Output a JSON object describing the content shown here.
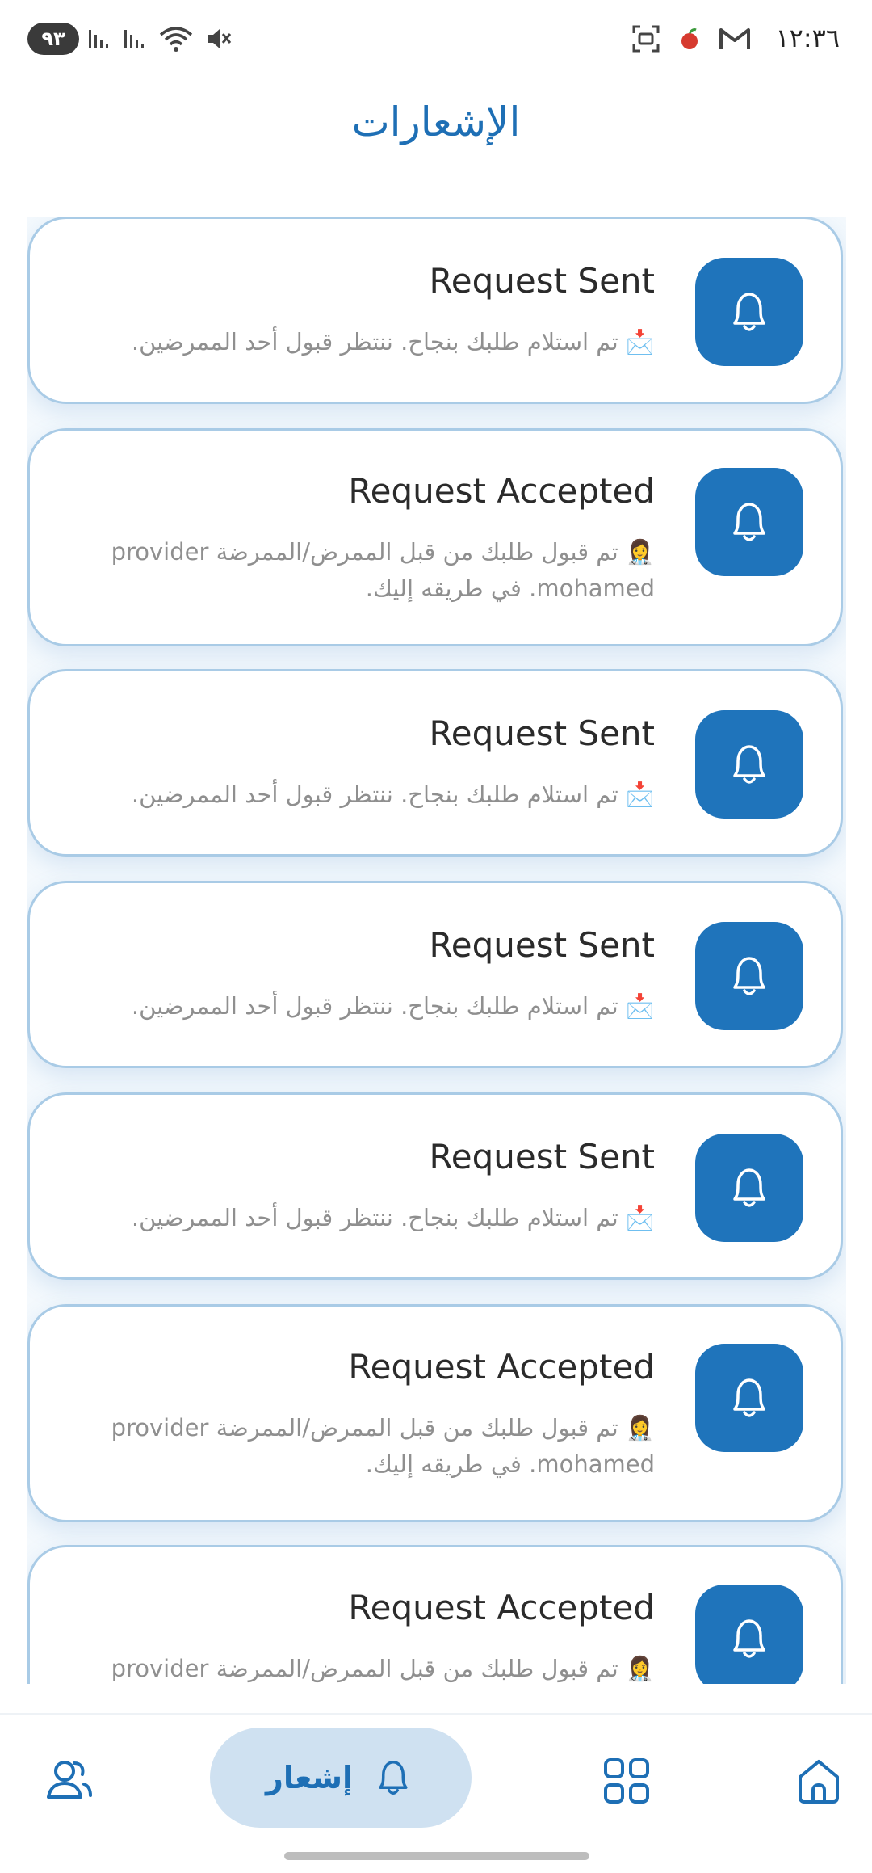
{
  "status_bar": {
    "time": "١٢:٣٦",
    "battery": "٩٣",
    "icons": [
      "mute-icon",
      "wifi-icon",
      "signal-icon",
      "signal-icon",
      "screenshot-icon",
      "app-notification-icon",
      "gmail-icon"
    ]
  },
  "page": {
    "title": "الإشعارات"
  },
  "notifications": [
    {
      "title": "Request Sent",
      "body_line1": "📩 تم استلام طلبك بنجاح. ننتظر قبول أحد الممرضين.",
      "body_line2": ""
    },
    {
      "title": "Request Accepted",
      "body_line1": "👩‍⚕️ تم قبول طلبك من قبل الممرض/الممرضة provider",
      "body_line2": "mohamed. في طريقه إليك."
    },
    {
      "title": "Request Sent",
      "body_line1": "📩 تم استلام طلبك بنجاح. ننتظر قبول أحد الممرضين.",
      "body_line2": ""
    },
    {
      "title": "Request Sent",
      "body_line1": "📩 تم استلام طلبك بنجاح. ننتظر قبول أحد الممرضين.",
      "body_line2": ""
    },
    {
      "title": "Request Sent",
      "body_line1": "📩 تم استلام طلبك بنجاح. ننتظر قبول أحد الممرضين.",
      "body_line2": ""
    },
    {
      "title": "Request Accepted",
      "body_line1": "👩‍⚕️ تم قبول طلبك من قبل الممرض/الممرضة provider",
      "body_line2": "mohamed. في طريقه إليك."
    },
    {
      "title": "Request Accepted",
      "body_line1": "👩‍⚕️ تم قبول طلبك من قبل الممرض/الممرضة provider",
      "body_line2": ""
    }
  ],
  "bottom_nav": {
    "active_label": "إشعار",
    "items": [
      "profile-icon",
      "notifications-icon",
      "grid-icon",
      "home-icon"
    ]
  },
  "colors": {
    "accent": "#1f74bb",
    "active_tab_bg": "#cfe1f1",
    "card_border": "#a9cbe6"
  }
}
